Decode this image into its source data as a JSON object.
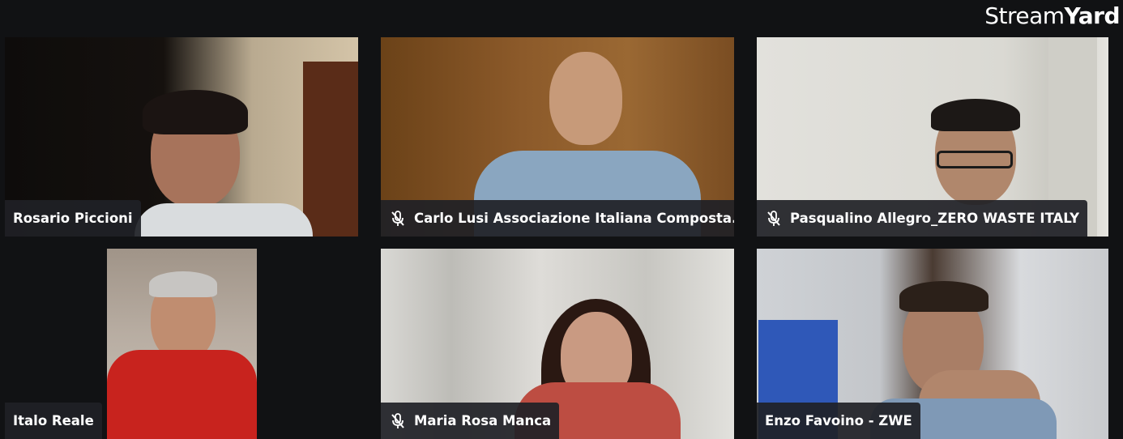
{
  "brand": {
    "part1": "Stream",
    "part2": "Yard"
  },
  "participants": [
    {
      "name": "Rosario Piccioni",
      "muted": false
    },
    {
      "name": "Carlo Lusi Associazione Italiana Composta...",
      "muted": true
    },
    {
      "name": "Pasqualino Allegro_ZERO WASTE ITALY",
      "muted": true
    },
    {
      "name": "Italo Reale",
      "muted": false
    },
    {
      "name": "Maria Rosa Manca",
      "muted": true
    },
    {
      "name": "Enzo Favoino - ZWE",
      "muted": false
    }
  ],
  "icons": {
    "muted": "mic-off-icon"
  },
  "colors": {
    "background": "#111214",
    "name_tag_bg": "#1f2126",
    "text": "#ffffff"
  }
}
